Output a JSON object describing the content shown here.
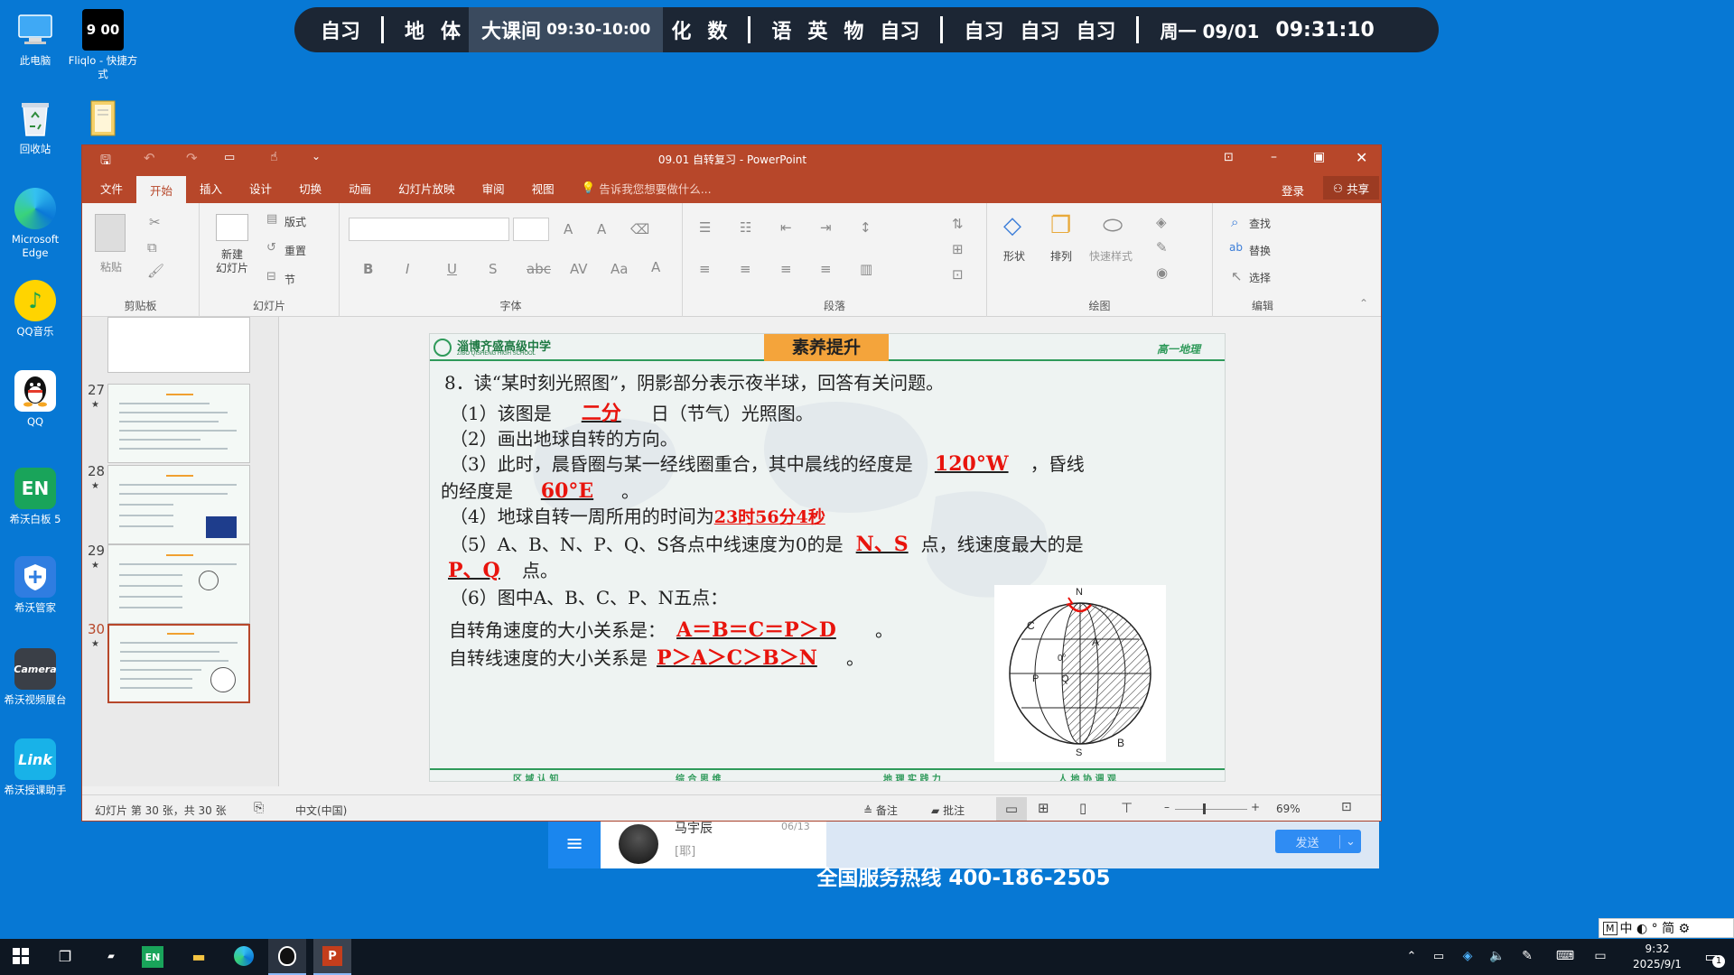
{
  "schedule": {
    "items": [
      "自习",
      "地",
      "体",
      "大课间",
      "化",
      "数",
      "语",
      "英",
      "物",
      "自习",
      "自习",
      "自习",
      "自习"
    ],
    "current_time_range": "09:30-10:00",
    "date": "周一 09/01",
    "clock": "09:31:10"
  },
  "desktop": {
    "icons": [
      {
        "label": "此电脑",
        "icon": "computer-icon"
      },
      {
        "label": "Fliqlo - 快捷方式",
        "icon": "clock-shortcut-icon",
        "glyph": "9 00"
      },
      {
        "label": "回收站",
        "icon": "recycle-bin-icon"
      },
      {
        "label": "",
        "icon": "folder-icon"
      },
      {
        "label": "Microsoft Edge",
        "icon": "edge-icon"
      },
      {
        "label": "QQ音乐",
        "icon": "qq-music-icon"
      },
      {
        "label": "QQ",
        "icon": "qq-icon"
      },
      {
        "label": "希沃白板 5",
        "icon": "seewo-board-icon",
        "glyph": "EN"
      },
      {
        "label": "希沃管家",
        "icon": "seewo-manager-icon"
      },
      {
        "label": "希沃视频展台",
        "icon": "seewo-camera-icon",
        "glyph": "Camera"
      },
      {
        "label": "希沃授课助手",
        "icon": "seewo-link-icon",
        "glyph": "Link"
      }
    ]
  },
  "behind_app": {
    "name": "马宇辰",
    "date": "06/13",
    "message": "[耶]",
    "send_label": "发送",
    "hotline": "全国服务热线 400-186-2505"
  },
  "ppt": {
    "title": "09.01 自转复习 - PowerPoint",
    "tabs": [
      "文件",
      "开始",
      "插入",
      "设计",
      "切换",
      "动画",
      "幻灯片放映",
      "审阅",
      "视图"
    ],
    "active_tab": "开始",
    "tell_me": "告诉我您想要做什么...",
    "login": "登录",
    "share": "共享",
    "ribbon": {
      "paste": "粘贴",
      "clipboard": "剪贴板",
      "new_slide": "新建\n幻灯片",
      "layout": "版式",
      "reset": "重置",
      "section": "节",
      "slides": "幻灯片",
      "font": "字体",
      "paragraph": "段落",
      "shape": "形状",
      "arrange": "排列",
      "quick_styles": "快速样式",
      "drawing": "绘图",
      "find": "查找",
      "replace": "替换",
      "select": "选择",
      "editing": "编辑"
    },
    "thumbs": [
      {
        "num": "27",
        "star": "★"
      },
      {
        "num": "28",
        "star": "★"
      },
      {
        "num": "29",
        "star": "★"
      },
      {
        "num": "30",
        "star": "★"
      }
    ],
    "status": {
      "slide_info": "幻灯片 第 30 张，共 30 张",
      "language": "中文(中国)",
      "notes": "备注",
      "comments": "批注",
      "zoom": "69%"
    },
    "accent": "#b7472a"
  },
  "slide": {
    "school": "淄博齐盛高级中学",
    "school_en": "ZIBO QISHENG HIGH SCHOOL",
    "banner": "素养提升",
    "grade": "高一地理",
    "question": "8．读“某时刻光照图”，阴影部分表示夜半球，回答有关问题。",
    "q1_pre": "（1）该图是",
    "q1_ans": "二分",
    "q1_post": "日（节气）光照图。",
    "q2": "（2）画出地球自转的方向。",
    "q3_pre": "（3）此时，晨昏圈与某一经线圈重合，其中晨线的经度是",
    "q3_ans1": "120°W",
    "q3_mid": "，昏线",
    "q3_pre2": "的经度是",
    "q3_ans2": "60°E",
    "q3_end": "。",
    "q4_pre": "（4）地球自转一周所用的时间为",
    "q4_ans": "23时56分4秒",
    "q5_pre": "（5）A、B、N、P、Q、S各点中线速度为0的是",
    "q5_ans1": "N、S",
    "q5_mid": "点，线速度最大的是",
    "q5_ans2": "P、Q",
    "q5_end": "点。",
    "q6": "（6）图中A、B、C、P、N五点：",
    "q6a_pre": "自转角速度的大小关系是：",
    "q6a_ans": "A＝B＝C＝P＞D",
    "q6a_end": "。",
    "q6b_pre": "自转线速度的大小关系是",
    "q6b_ans": "P＞A＞C＞B＞N",
    "q6b_end": "。",
    "diagram_labels": [
      "N",
      "S",
      "A",
      "B",
      "C",
      "P",
      "Q",
      "0°"
    ],
    "footer": [
      "区 域 认 知",
      "综 合 思 维",
      "地 理 实 践 力",
      "人 地 协 调 观"
    ]
  },
  "taskbar": {
    "ime": "中 ◐ ° 简 ⚙",
    "time": "9:32",
    "date": "2025/9/1",
    "notify_count": "1"
  }
}
